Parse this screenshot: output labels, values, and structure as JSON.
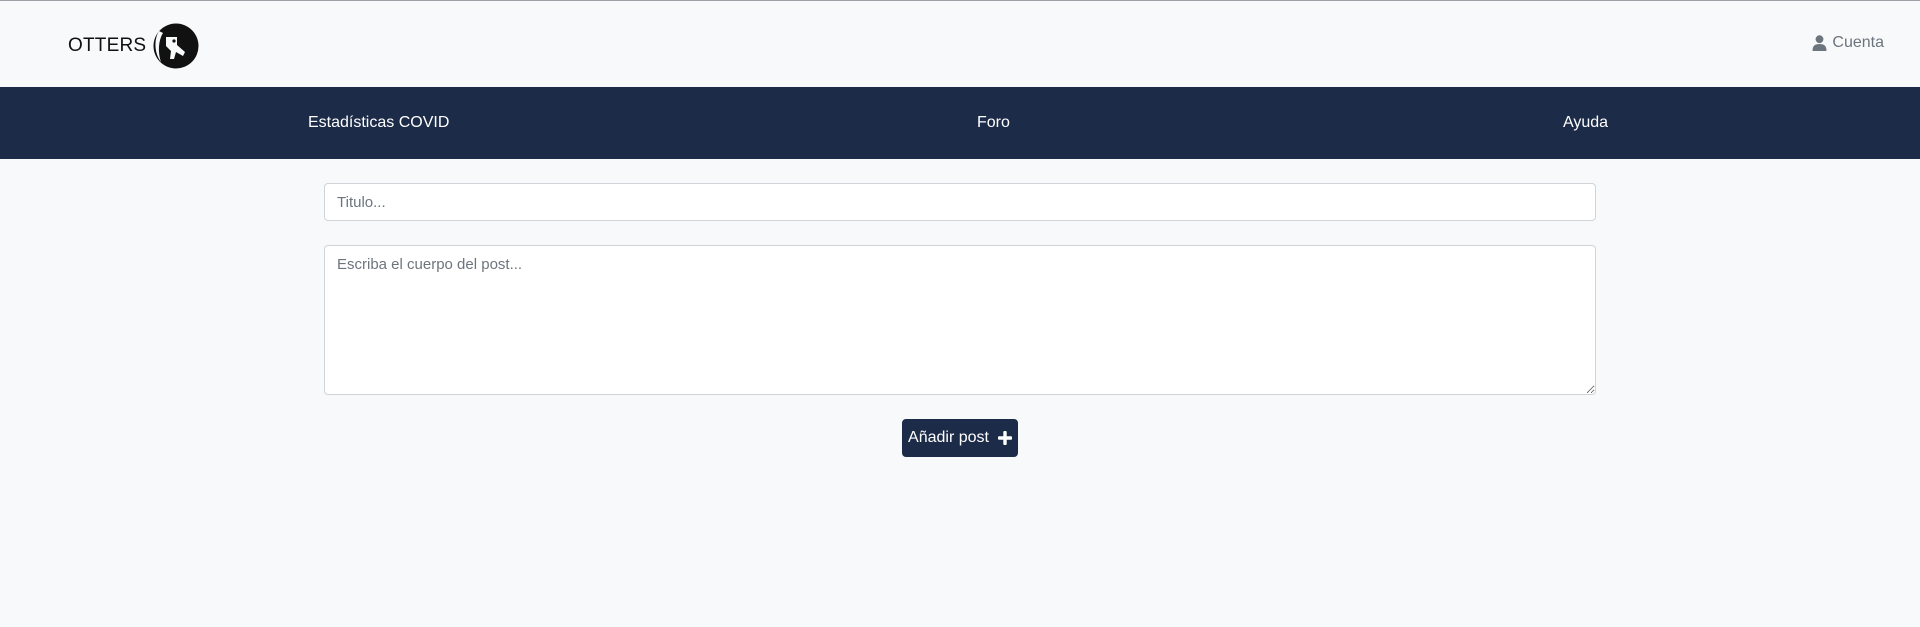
{
  "header": {
    "brand": "OTTERS",
    "logo_icon": "otter-logo-icon",
    "account_icon": "user-icon",
    "account_label": "Cuenta"
  },
  "nav": {
    "items": [
      {
        "label": "Estadísticas COVID"
      },
      {
        "label": "Foro"
      },
      {
        "label": "Ayuda"
      }
    ]
  },
  "form": {
    "title_placeholder": "Titulo...",
    "title_value": "",
    "body_placeholder": "Escriba el cuerpo del post...",
    "body_value": "",
    "submit_label": "Añadir post",
    "submit_icon": "plus-icon"
  },
  "colors": {
    "navbar": "#1c2b48",
    "background": "#f8f9fa",
    "button": "#1c2b48"
  }
}
